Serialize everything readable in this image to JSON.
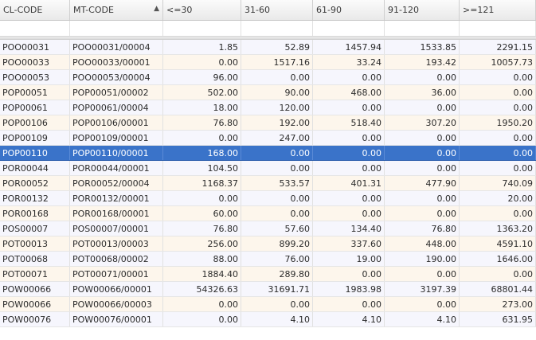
{
  "columns": [
    "CL-CODE",
    "MT-CODE",
    "<=30",
    "31-60",
    "61-90",
    "91-120",
    ">=121"
  ],
  "sort_indicator": "▲",
  "rows": [
    [
      "POO00031",
      "POO00031/00004",
      "1.85",
      "52.89",
      "1457.94",
      "1533.85",
      "2291.15"
    ],
    [
      "POO00033",
      "POO00033/00001",
      "0.00",
      "1517.16",
      "33.24",
      "193.42",
      "10057.73"
    ],
    [
      "POO00053",
      "POO00053/00004",
      "96.00",
      "0.00",
      "0.00",
      "0.00",
      "0.00"
    ],
    [
      "POP00051",
      "POP00051/00002",
      "502.00",
      "90.00",
      "468.00",
      "36.00",
      "0.00"
    ],
    [
      "POP00061",
      "POP00061/00004",
      "18.00",
      "120.00",
      "0.00",
      "0.00",
      "0.00"
    ],
    [
      "POP00106",
      "POP00106/00001",
      "76.80",
      "192.00",
      "518.40",
      "307.20",
      "1950.20"
    ],
    [
      "POP00109",
      "POP00109/00001",
      "0.00",
      "247.00",
      "0.00",
      "0.00",
      "0.00"
    ],
    [
      "POP00110",
      "POP00110/00001",
      "168.00",
      "0.00",
      "0.00",
      "0.00",
      "0.00"
    ],
    [
      "POR00044",
      "POR00044/00001",
      "104.50",
      "0.00",
      "0.00",
      "0.00",
      "0.00"
    ],
    [
      "POR00052",
      "POR00052/00004",
      "1168.37",
      "533.57",
      "401.31",
      "477.90",
      "740.09"
    ],
    [
      "POR00132",
      "POR00132/00001",
      "0.00",
      "0.00",
      "0.00",
      "0.00",
      "20.00"
    ],
    [
      "POR00168",
      "POR00168/00001",
      "60.00",
      "0.00",
      "0.00",
      "0.00",
      "0.00"
    ],
    [
      "POS00007",
      "POS00007/00001",
      "76.80",
      "57.60",
      "134.40",
      "76.80",
      "1363.20"
    ],
    [
      "POT00013",
      "POT00013/00003",
      "256.00",
      "899.20",
      "337.60",
      "448.00",
      "4591.10"
    ],
    [
      "POT00068",
      "POT00068/00002",
      "88.00",
      "76.00",
      "19.00",
      "190.00",
      "1646.00"
    ],
    [
      "POT00071",
      "POT00071/00001",
      "1884.40",
      "289.80",
      "0.00",
      "0.00",
      "0.00"
    ],
    [
      "POW00066",
      "POW00066/00001",
      "54326.63",
      "31691.71",
      "1983.98",
      "3197.39",
      "68801.44"
    ],
    [
      "POW00066",
      "POW00066/00003",
      "0.00",
      "0.00",
      "0.00",
      "0.00",
      "273.00"
    ],
    [
      "POW00076",
      "POW00076/00001",
      "0.00",
      "4.10",
      "4.10",
      "4.10",
      "631.95"
    ]
  ],
  "selected_row_index": 7
}
